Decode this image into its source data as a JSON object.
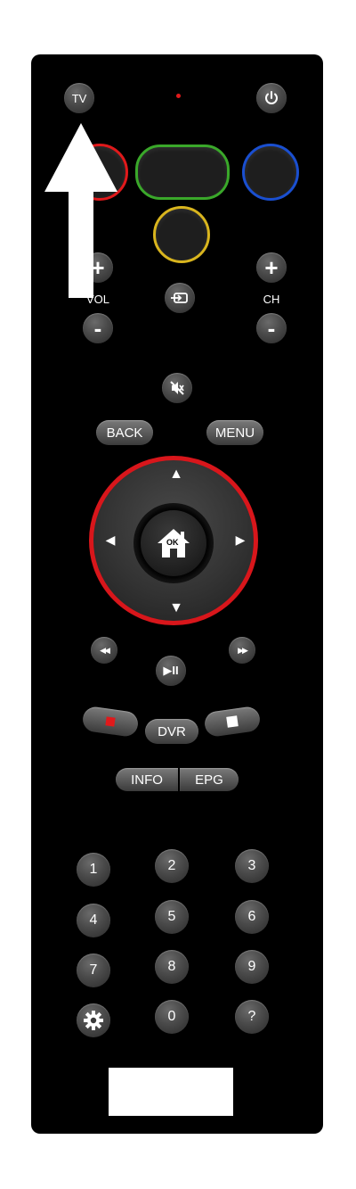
{
  "top": {
    "tv_label": "TV",
    "indicator_color": "#e0191b"
  },
  "colors": {
    "red": "#e0191b",
    "green": "#3aa82a",
    "blue": "#1a4fd0",
    "yellow": "#d9b51e"
  },
  "volume": {
    "plus": "+",
    "label": "VOL",
    "minus": "-"
  },
  "channel": {
    "plus": "+",
    "label": "CH",
    "minus": "-"
  },
  "nav": {
    "back_label": "BACK",
    "menu_label": "MENU",
    "ok_label": "OK",
    "up": "▲",
    "down": "▼",
    "left": "◀",
    "right": "▶"
  },
  "playback": {
    "rewind": "◀◀",
    "fast_forward": "▶▶",
    "play_pause": "▶II",
    "dvr_label": "DVR"
  },
  "info": {
    "info_label": "INFO",
    "epg_label": "EPG"
  },
  "keypad": {
    "keys": [
      "1",
      "2",
      "3",
      "4",
      "5",
      "6",
      "7",
      "8",
      "9",
      "0",
      "?"
    ]
  },
  "icons": {
    "power": "power-icon",
    "input": "input-icon",
    "mute": "mute-icon",
    "home": "home-icon",
    "settings": "gear-icon",
    "record": "record-icon",
    "stop": "stop-icon"
  }
}
